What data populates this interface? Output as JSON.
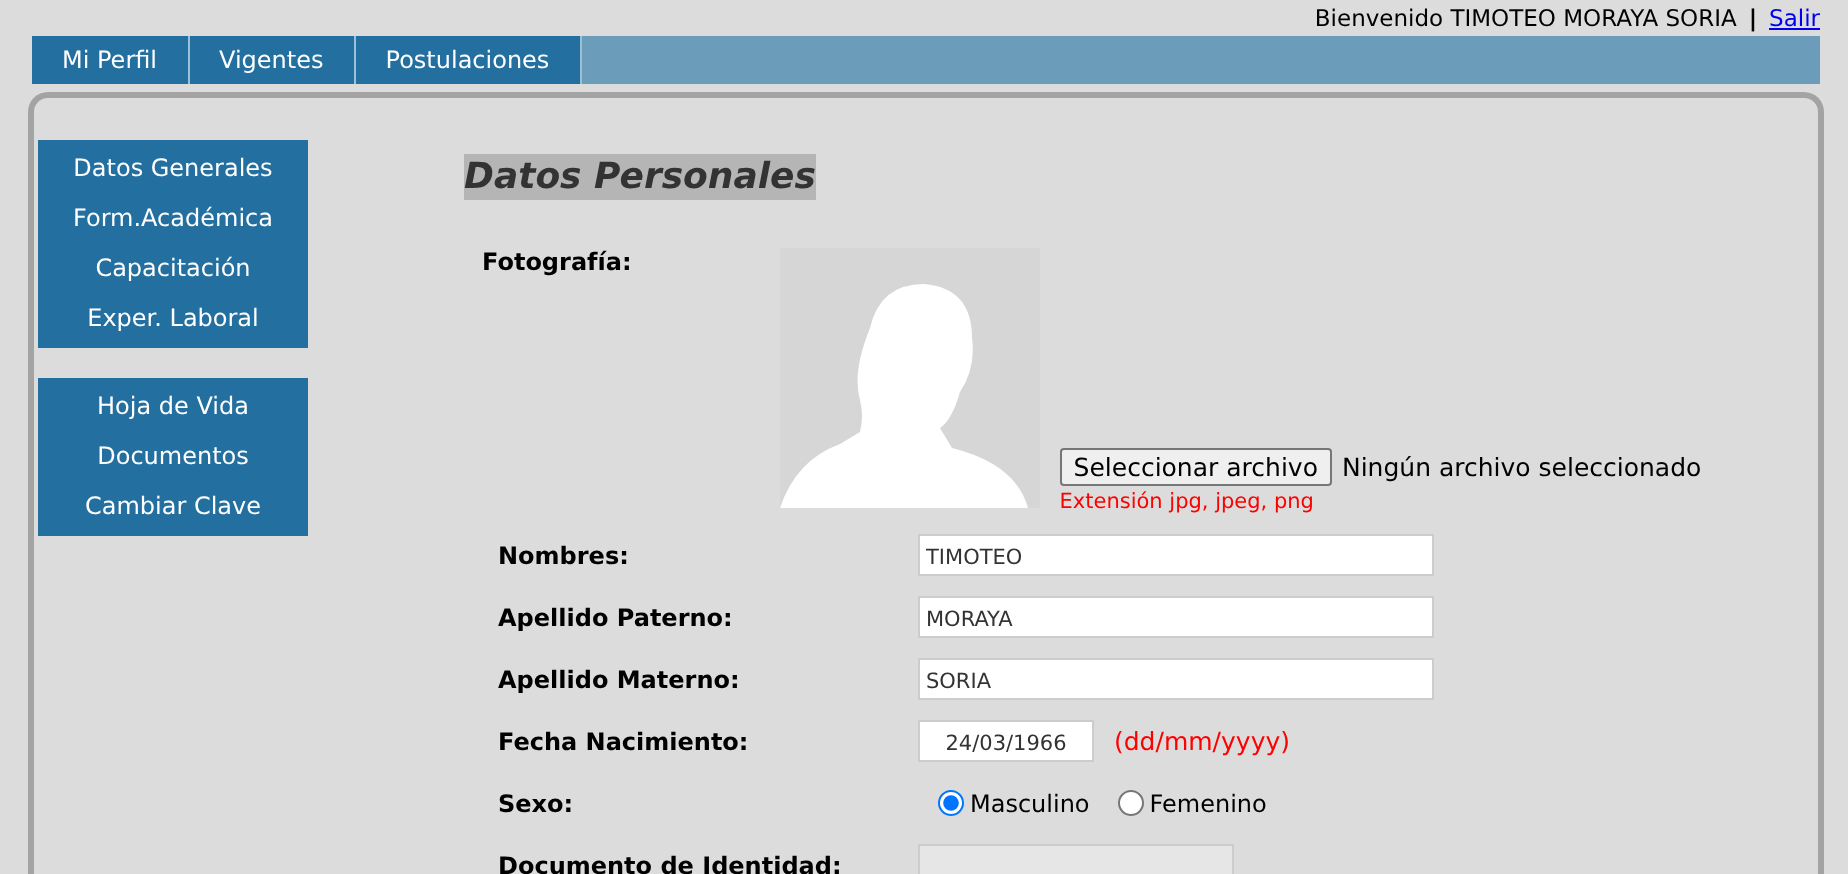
{
  "header": {
    "welcome": "Bienvenido TIMOTEO MORAYA SORIA",
    "separator": "|",
    "logout": "Salir"
  },
  "tabs": [
    {
      "label": "Mi Perfil"
    },
    {
      "label": "Vigentes"
    },
    {
      "label": "Postulaciones"
    }
  ],
  "sidebar": {
    "groups": [
      {
        "items": [
          "Datos Generales",
          "Form.Académica",
          "Capacitación",
          "Exper. Laboral"
        ]
      },
      {
        "items": [
          "Hoja de Vida",
          "Documentos",
          "Cambiar Clave"
        ]
      }
    ]
  },
  "title": "Datos Personales",
  "photo": {
    "label": "Fotografía:",
    "button": "Seleccionar archivo",
    "status": "Ningún archivo seleccionado",
    "hint": "Extensión jpg, jpeg, png"
  },
  "fields": [
    {
      "kind": "text",
      "label": "Nombres:",
      "value": "TIMOTEO"
    },
    {
      "kind": "text",
      "label": "Apellido Paterno:",
      "value": "MORAYA"
    },
    {
      "kind": "text",
      "label": "Apellido Materno:",
      "value": "SORIA"
    },
    {
      "kind": "date",
      "label": "Fecha Nacimiento:",
      "value": "24/03/1966",
      "hint": "(dd/mm/yyyy)"
    },
    {
      "kind": "radio",
      "label": "Sexo:",
      "options": [
        {
          "label": "Masculino",
          "selected": true
        },
        {
          "label": "Femenino",
          "selected": false
        }
      ]
    },
    {
      "kind": "readonly",
      "label": "Documento de Identidad:"
    }
  ]
}
